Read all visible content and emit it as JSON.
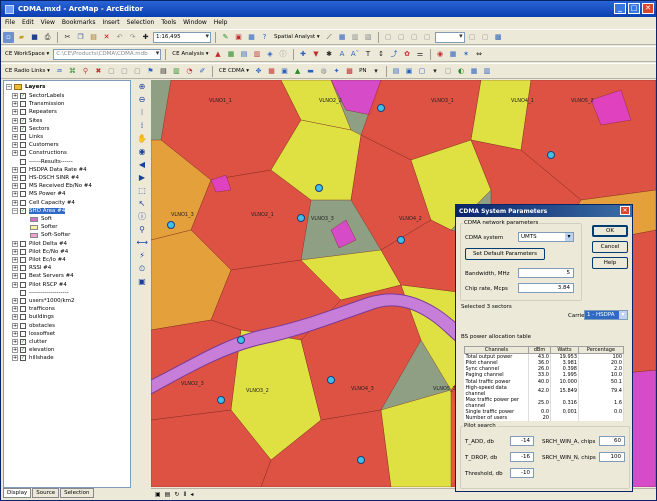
{
  "window": {
    "title": "CDMA.mxd - ArcMap - ArcEditor",
    "controls": [
      "_",
      "□",
      "✕"
    ]
  },
  "menu": [
    "File",
    "Edit",
    "View",
    "Bookmarks",
    "Insert",
    "Selection",
    "Tools",
    "Window",
    "Help"
  ],
  "toolbar1": {
    "scale": "1:16,495",
    "spatial_analyst": "Spatial Analyst ▾"
  },
  "toolbar2": {
    "workspace_label": "CE WorkSpace ▾",
    "workspace_path": "C:\\CE\\Products\\CDMA\\CDMA.mdb",
    "analysis_label": "CE Analysis ▾"
  },
  "toolbar3": {
    "radio_links": "CE Radio Links ▾",
    "cdma_menu": "CE CDMA ▾",
    "pn_label": "PN"
  },
  "toc": {
    "root": "Layers",
    "layers": [
      {
        "label": "SectorLabels",
        "checked": true,
        "expander": "+"
      },
      {
        "label": "Transmission",
        "checked": false,
        "expander": "+"
      },
      {
        "label": "Repeaters",
        "checked": false,
        "expander": "+"
      },
      {
        "label": "Sites",
        "checked": true,
        "expander": "+"
      },
      {
        "label": "Sectors",
        "checked": true,
        "expander": "+"
      },
      {
        "label": "Links",
        "checked": false,
        "expander": "+"
      },
      {
        "label": "Customers",
        "checked": false,
        "expander": "+"
      },
      {
        "label": "Constructions",
        "checked": false,
        "expander": "+"
      },
      {
        "label": "------Results------",
        "checked": false,
        "expander": ""
      },
      {
        "label": "HSDPA Data Rate #4",
        "checked": false,
        "expander": "+"
      },
      {
        "label": "HS-DSCH SINR #4",
        "checked": false,
        "expander": "+"
      },
      {
        "label": "MS Received Eb/No #4",
        "checked": false,
        "expander": "+"
      },
      {
        "label": "MS Power #4",
        "checked": false,
        "expander": "+"
      },
      {
        "label": "Cell Capacity #4",
        "checked": false,
        "expander": "+"
      },
      {
        "label": "SHO Area #4",
        "checked": true,
        "expander": "−",
        "selected": true
      },
      {
        "label": "Soft",
        "swatch": "#d070c8"
      },
      {
        "label": "Softer",
        "swatch": "#f8f0a0"
      },
      {
        "label": "Soft-Softer",
        "swatch": "#f0a0d0"
      },
      {
        "label": "Pilot Delta #4",
        "checked": false,
        "expander": "+"
      },
      {
        "label": "Pilot Ec/No #4",
        "checked": false,
        "expander": "+"
      },
      {
        "label": "Pilot Ec/Io #4",
        "checked": false,
        "expander": "+"
      },
      {
        "label": "RSSI #4",
        "checked": false,
        "expander": "+"
      },
      {
        "label": "Best Servers #4",
        "checked": false,
        "expander": "+"
      },
      {
        "label": "Pilot RSCP #4",
        "checked": false,
        "expander": "+"
      },
      {
        "label": "--------------------",
        "checked": false,
        "expander": ""
      },
      {
        "label": "users*1000/km2",
        "checked": false,
        "expander": "+"
      },
      {
        "label": "trafficons",
        "checked": false,
        "expander": "+"
      },
      {
        "label": "buildings",
        "checked": false,
        "expander": "+"
      },
      {
        "label": "obstacles",
        "checked": false,
        "expander": "+"
      },
      {
        "label": "lossoffset",
        "checked": false,
        "expander": "+"
      },
      {
        "label": "clutter",
        "checked": true,
        "expander": "+"
      },
      {
        "label": "elevation",
        "checked": true,
        "expander": "+"
      },
      {
        "label": "hillshade",
        "checked": true,
        "expander": "+"
      }
    ],
    "tabs": [
      "Display",
      "Source",
      "Selection"
    ]
  },
  "map_labels": [
    "VLNO1_1",
    "VLNO2_2",
    "VLNO3_1",
    "VLNO4_1",
    "VLNO5_2",
    "VLNO1_3",
    "VLNO2_1",
    "VLNO3_3",
    "VLNO4_2",
    "VLNO5_1",
    "VLNO2_3",
    "VLNO3_2",
    "VLNO4_3",
    "VLNO5_3"
  ],
  "dialog": {
    "title": "CDMA System Parameters",
    "network_group": "CDMA network parameters",
    "system_label": "CDMA system",
    "system_value": "UMTS",
    "default_button": "Set Default Parameters",
    "bandwidth_label": "Bandwidth, MHz",
    "bandwidth_value": "5",
    "chiprate_label": "Chip rate, Mcps",
    "chiprate_value": "3.84",
    "ok": "OK",
    "cancel": "Cancel",
    "help": "Help",
    "selected": "Selected 3 sectors",
    "carrier_label": "Carrier",
    "carrier_value": "1 - HSDPA",
    "table_title": "BS power allocation table",
    "columns": [
      "Channels",
      "dBm",
      "Watts",
      "Percentage"
    ],
    "rows": [
      [
        "Total output power",
        "43.0",
        "19.953",
        "100"
      ],
      [
        "Pilot channel",
        "36.0",
        "3.981",
        "20.0"
      ],
      [
        "Sync channel",
        "26.0",
        "0.398",
        "2.0"
      ],
      [
        "Paging channel",
        "33.0",
        "1.995",
        "10.0"
      ],
      [
        "Total traffic power",
        "40.0",
        "10.000",
        "50.1"
      ],
      [
        "High-speed data channel",
        "42.0",
        "15.849",
        "79.4"
      ],
      [
        "Max traffic power per channel",
        "25.0",
        "0.316",
        "1.6"
      ],
      [
        "Single traffic power",
        "0.0",
        "0.001",
        "0.0"
      ],
      [
        "Number of users",
        "20",
        "",
        ""
      ]
    ],
    "pilot_group": "Pilot search",
    "tadd_label": "T_ADD, db",
    "tadd_value": "-14",
    "tdrop_label": "T_DROP, db",
    "tdrop_value": "-16",
    "threshold_label": "Threshold, db",
    "threshold_value": "-10",
    "win_a_label": "SRCH_WIN_A, chips",
    "win_a_value": "60",
    "win_n_label": "SRCH_WIN_N, chips",
    "win_n_value": "100"
  },
  "colors": {
    "red": "#e8483a",
    "yellow": "#eaea3a",
    "magenta": "#e040d0",
    "orange": "#f0a030",
    "river": "#c080d0"
  }
}
